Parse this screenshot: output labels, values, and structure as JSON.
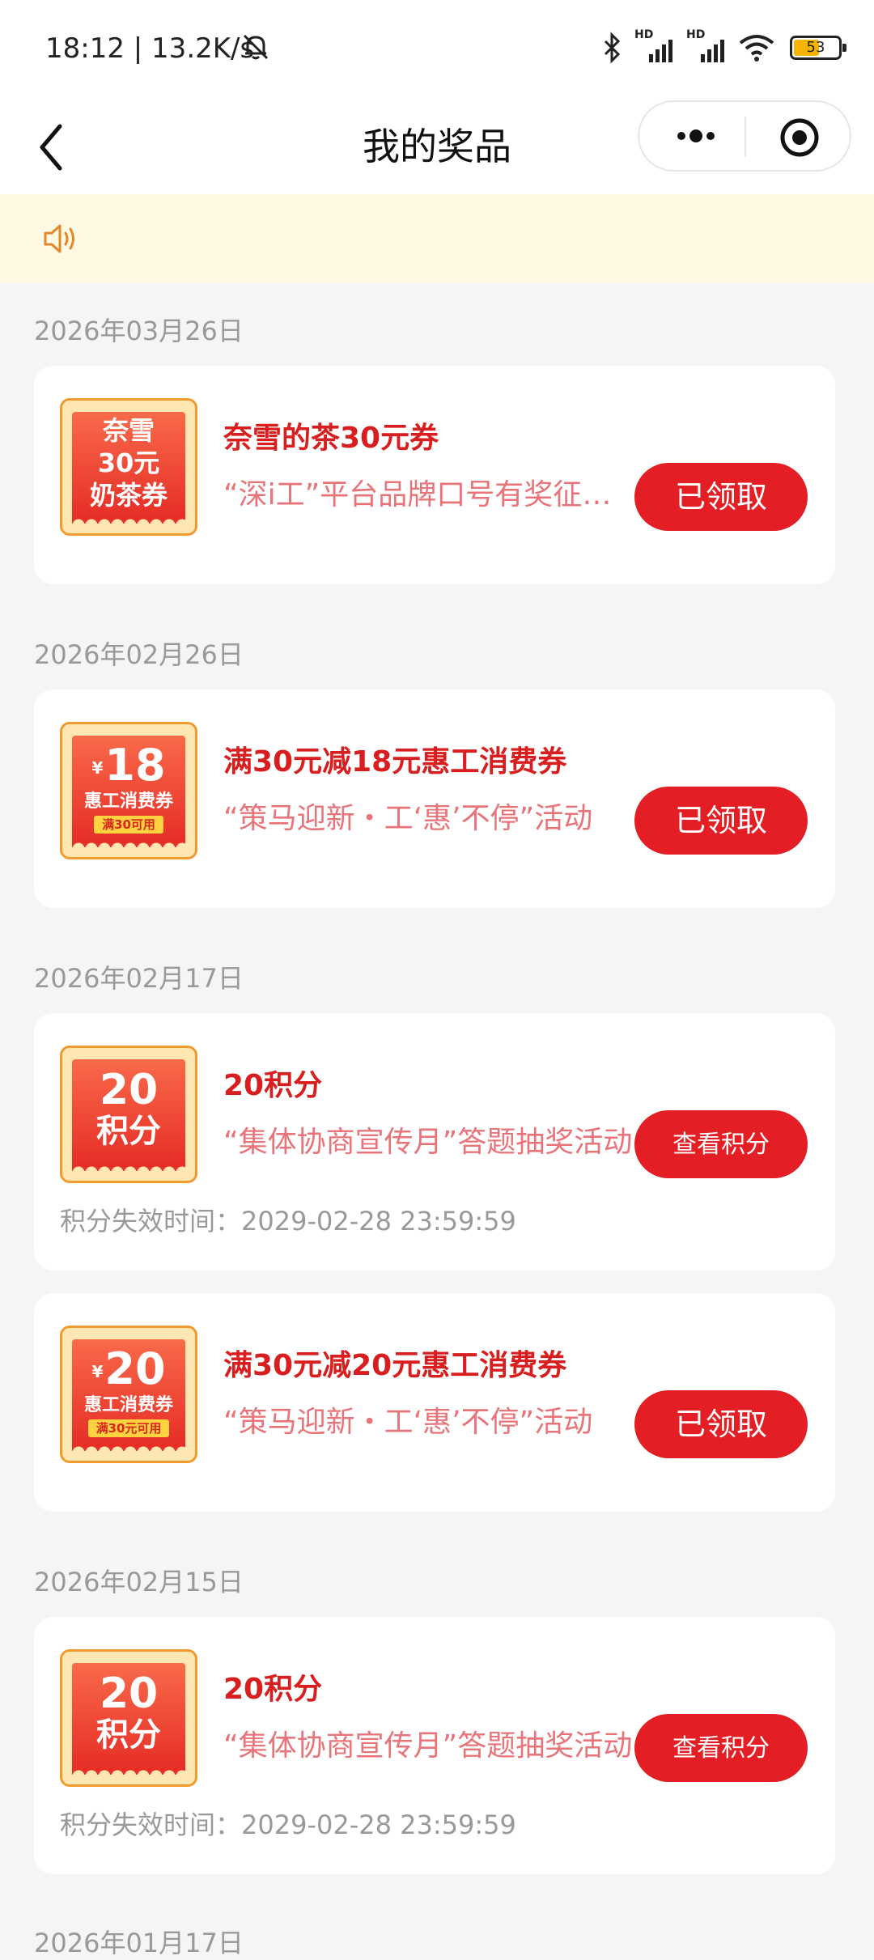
{
  "status_bar": {
    "time": "18:12 | 13.2K/s",
    "hd1": "HD",
    "hd2": "HD",
    "battery": "53"
  },
  "nav": {
    "title": "我的奖品"
  },
  "prizes": [
    {
      "date": "2026年03月26日",
      "cards": [
        {
          "thumb": {
            "line1": "奈雪",
            "line2": "30元",
            "line3": "奶茶券"
          },
          "name": "奈雪的茶30元券",
          "desc": "“深i工”平台品牌口号有奖征集活动",
          "button": "已领取"
        }
      ]
    },
    {
      "date": "2026年02月26日",
      "cards": [
        {
          "thumb": {
            "yen": "¥",
            "amount": "18",
            "label": "惠工消费券",
            "tag": "满30可用"
          },
          "name": "满30元减18元惠工消费券",
          "desc": "“策马迎新・工‘惠’不停”活动",
          "button": "已领取"
        }
      ]
    },
    {
      "date": "2026年02月17日",
      "cards": [
        {
          "thumb": {
            "amount": "20",
            "label": "积分"
          },
          "name": "20积分",
          "desc": "“集体协商宣传月”答题抽奖活动",
          "button": "查看积分",
          "expire": "积分失效时间：2029-02-28 23:59:59"
        },
        {
          "thumb": {
            "yen": "¥",
            "amount": "20",
            "label": "惠工消费券",
            "tag": "满30元可用"
          },
          "name": "满30元减20元惠工消费券",
          "desc": "“策马迎新・工‘惠’不停”活动",
          "button": "已领取"
        }
      ]
    },
    {
      "date": "2026年02月15日",
      "cards": [
        {
          "thumb": {
            "amount": "20",
            "label": "积分"
          },
          "name": "20积分",
          "desc": "“集体协商宣传月”答题抽奖活动",
          "button": "查看积分",
          "expire": "积分失效时间：2029-02-28 23:59:59"
        }
      ]
    },
    {
      "date": "2026年01月17日",
      "cards": []
    }
  ],
  "colors": {
    "accent": "#e31e24",
    "title_red": "#d81e1e",
    "desc_pink": "#e8747a",
    "notice_bg": "#fff9e4",
    "thumb_border": "#f39a2c"
  },
  "icons": {
    "back": "back-arrow-icon",
    "more": "more-dots-icon",
    "close": "target-circle-icon",
    "notice": "speaker-icon",
    "mute": "bell-off-icon",
    "bluetooth": "bluetooth-icon",
    "wifi": "wifi-icon"
  }
}
